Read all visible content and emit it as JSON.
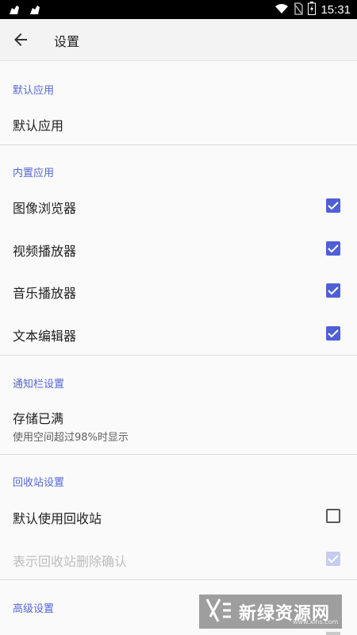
{
  "status_bar": {
    "time": "15:31"
  },
  "toolbar": {
    "title": "设置"
  },
  "sections": {
    "default_apps": {
      "header": "默认应用",
      "item_label": "默认应用"
    },
    "builtin_apps": {
      "header": "内置应用",
      "items": [
        {
          "label": "图像浏览器",
          "checked": true
        },
        {
          "label": "视频播放器",
          "checked": true
        },
        {
          "label": "音乐播放器",
          "checked": true
        },
        {
          "label": "文本编辑器",
          "checked": true
        }
      ]
    },
    "notification": {
      "header": "通知栏设置",
      "title": "存储已满",
      "subtitle": "使用空间超过98%时显示"
    },
    "recycle": {
      "header": "回收站设置",
      "items": [
        {
          "label": "默认使用回收站",
          "checked": false
        },
        {
          "label": "表示回收站删除确认",
          "checked": true,
          "disabled": true
        }
      ]
    },
    "advanced": {
      "header": "高级设置"
    }
  },
  "watermark": {
    "text": "新绿资源网",
    "url": "www.xlhs.com"
  },
  "colors": {
    "accent": "#4f5fd6",
    "header_text": "#5466d8"
  }
}
